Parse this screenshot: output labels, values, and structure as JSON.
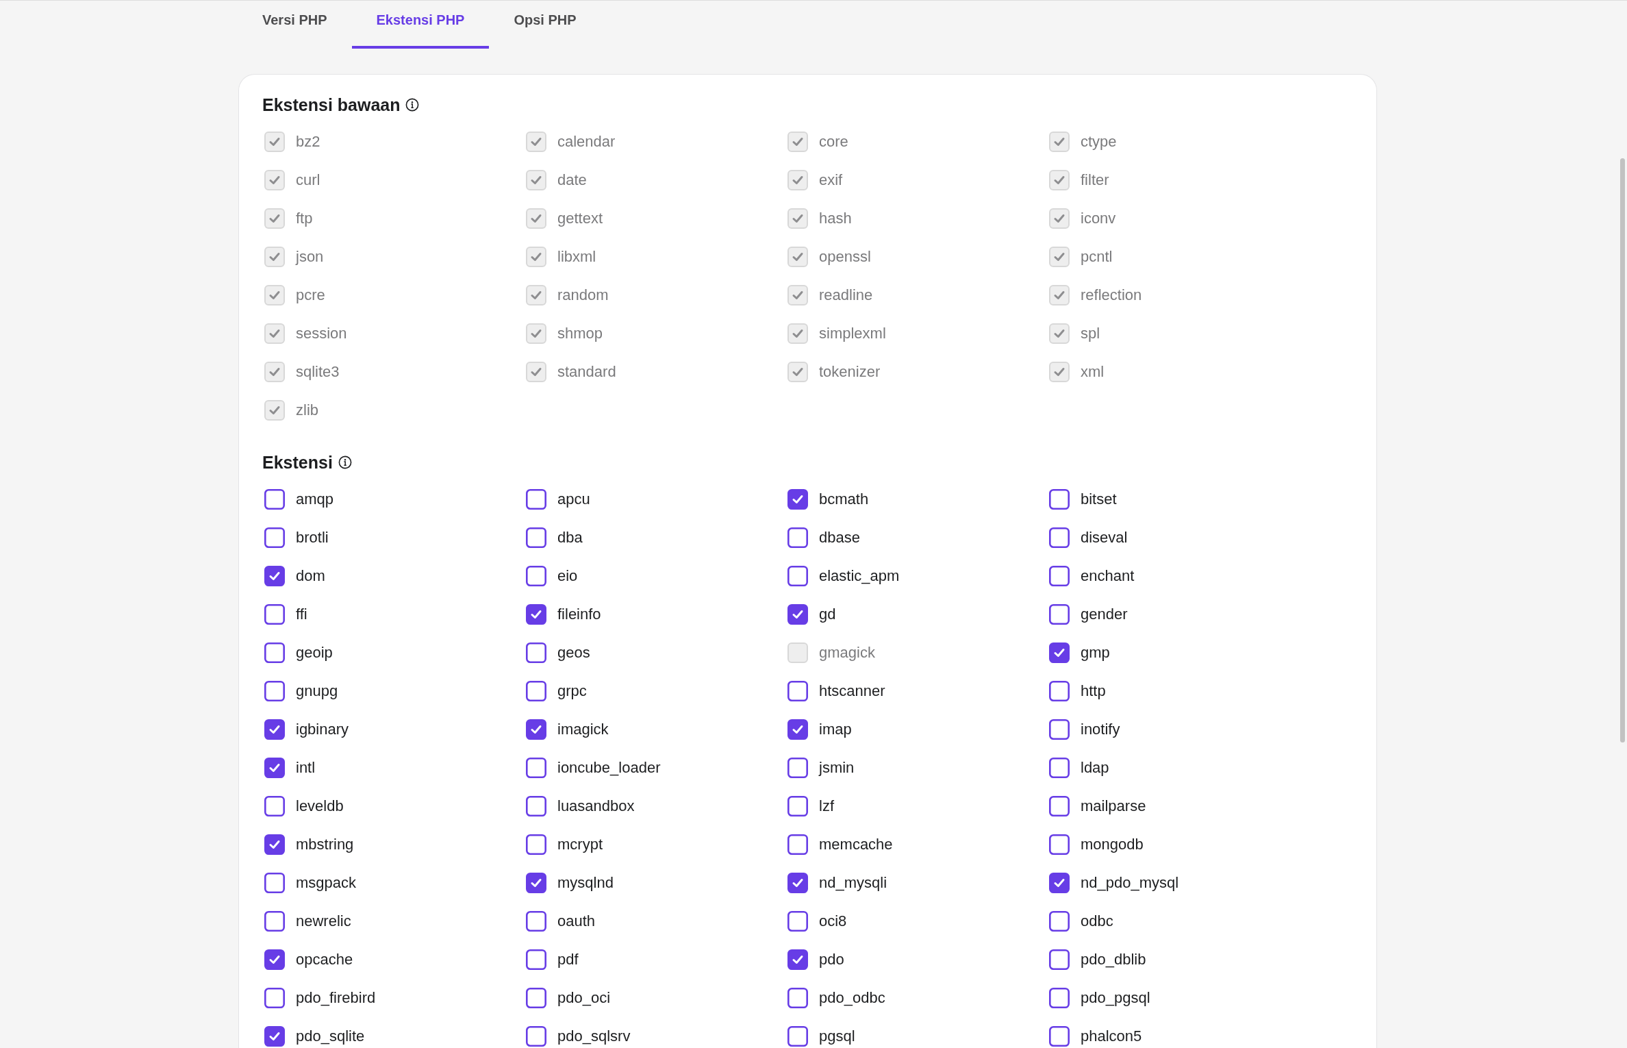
{
  "tabs": [
    {
      "label": "Versi PHP",
      "selected": false
    },
    {
      "label": "Ekstensi PHP",
      "selected": true
    },
    {
      "label": "Opsi PHP",
      "selected": false
    }
  ],
  "sections": [
    {
      "title": "Ekstensi bawaan",
      "items": [
        {
          "label": "bz2",
          "checked": true,
          "disabled": true
        },
        {
          "label": "calendar",
          "checked": true,
          "disabled": true
        },
        {
          "label": "core",
          "checked": true,
          "disabled": true
        },
        {
          "label": "ctype",
          "checked": true,
          "disabled": true
        },
        {
          "label": "curl",
          "checked": true,
          "disabled": true
        },
        {
          "label": "date",
          "checked": true,
          "disabled": true
        },
        {
          "label": "exif",
          "checked": true,
          "disabled": true
        },
        {
          "label": "filter",
          "checked": true,
          "disabled": true
        },
        {
          "label": "ftp",
          "checked": true,
          "disabled": true
        },
        {
          "label": "gettext",
          "checked": true,
          "disabled": true
        },
        {
          "label": "hash",
          "checked": true,
          "disabled": true
        },
        {
          "label": "iconv",
          "checked": true,
          "disabled": true
        },
        {
          "label": "json",
          "checked": true,
          "disabled": true
        },
        {
          "label": "libxml",
          "checked": true,
          "disabled": true
        },
        {
          "label": "openssl",
          "checked": true,
          "disabled": true
        },
        {
          "label": "pcntl",
          "checked": true,
          "disabled": true
        },
        {
          "label": "pcre",
          "checked": true,
          "disabled": true
        },
        {
          "label": "random",
          "checked": true,
          "disabled": true
        },
        {
          "label": "readline",
          "checked": true,
          "disabled": true
        },
        {
          "label": "reflection",
          "checked": true,
          "disabled": true
        },
        {
          "label": "session",
          "checked": true,
          "disabled": true
        },
        {
          "label": "shmop",
          "checked": true,
          "disabled": true
        },
        {
          "label": "simplexml",
          "checked": true,
          "disabled": true
        },
        {
          "label": "spl",
          "checked": true,
          "disabled": true
        },
        {
          "label": "sqlite3",
          "checked": true,
          "disabled": true
        },
        {
          "label": "standard",
          "checked": true,
          "disabled": true
        },
        {
          "label": "tokenizer",
          "checked": true,
          "disabled": true
        },
        {
          "label": "xml",
          "checked": true,
          "disabled": true
        },
        {
          "label": "zlib",
          "checked": true,
          "disabled": true
        }
      ]
    },
    {
      "title": "Ekstensi",
      "items": [
        {
          "label": "amqp",
          "checked": false,
          "disabled": false
        },
        {
          "label": "apcu",
          "checked": false,
          "disabled": false
        },
        {
          "label": "bcmath",
          "checked": true,
          "disabled": false
        },
        {
          "label": "bitset",
          "checked": false,
          "disabled": false
        },
        {
          "label": "brotli",
          "checked": false,
          "disabled": false
        },
        {
          "label": "dba",
          "checked": false,
          "disabled": false
        },
        {
          "label": "dbase",
          "checked": false,
          "disabled": false
        },
        {
          "label": "diseval",
          "checked": false,
          "disabled": false
        },
        {
          "label": "dom",
          "checked": true,
          "disabled": false
        },
        {
          "label": "eio",
          "checked": false,
          "disabled": false
        },
        {
          "label": "elastic_apm",
          "checked": false,
          "disabled": false
        },
        {
          "label": "enchant",
          "checked": false,
          "disabled": false
        },
        {
          "label": "ffi",
          "checked": false,
          "disabled": false
        },
        {
          "label": "fileinfo",
          "checked": true,
          "disabled": false
        },
        {
          "label": "gd",
          "checked": true,
          "disabled": false
        },
        {
          "label": "gender",
          "checked": false,
          "disabled": false
        },
        {
          "label": "geoip",
          "checked": false,
          "disabled": false
        },
        {
          "label": "geos",
          "checked": false,
          "disabled": false
        },
        {
          "label": "gmagick",
          "checked": false,
          "disabled": true
        },
        {
          "label": "gmp",
          "checked": true,
          "disabled": false
        },
        {
          "label": "gnupg",
          "checked": false,
          "disabled": false
        },
        {
          "label": "grpc",
          "checked": false,
          "disabled": false
        },
        {
          "label": "htscanner",
          "checked": false,
          "disabled": false
        },
        {
          "label": "http",
          "checked": false,
          "disabled": false
        },
        {
          "label": "igbinary",
          "checked": true,
          "disabled": false
        },
        {
          "label": "imagick",
          "checked": true,
          "disabled": false
        },
        {
          "label": "imap",
          "checked": true,
          "disabled": false
        },
        {
          "label": "inotify",
          "checked": false,
          "disabled": false
        },
        {
          "label": "intl",
          "checked": true,
          "disabled": false
        },
        {
          "label": "ioncube_loader",
          "checked": false,
          "disabled": false
        },
        {
          "label": "jsmin",
          "checked": false,
          "disabled": false
        },
        {
          "label": "ldap",
          "checked": false,
          "disabled": false
        },
        {
          "label": "leveldb",
          "checked": false,
          "disabled": false
        },
        {
          "label": "luasandbox",
          "checked": false,
          "disabled": false
        },
        {
          "label": "lzf",
          "checked": false,
          "disabled": false
        },
        {
          "label": "mailparse",
          "checked": false,
          "disabled": false
        },
        {
          "label": "mbstring",
          "checked": true,
          "disabled": false
        },
        {
          "label": "mcrypt",
          "checked": false,
          "disabled": false
        },
        {
          "label": "memcache",
          "checked": false,
          "disabled": false
        },
        {
          "label": "mongodb",
          "checked": false,
          "disabled": false
        },
        {
          "label": "msgpack",
          "checked": false,
          "disabled": false
        },
        {
          "label": "mysqlnd",
          "checked": true,
          "disabled": false
        },
        {
          "label": "nd_mysqli",
          "checked": true,
          "disabled": false
        },
        {
          "label": "nd_pdo_mysql",
          "checked": true,
          "disabled": false
        },
        {
          "label": "newrelic",
          "checked": false,
          "disabled": false
        },
        {
          "label": "oauth",
          "checked": false,
          "disabled": false
        },
        {
          "label": "oci8",
          "checked": false,
          "disabled": false
        },
        {
          "label": "odbc",
          "checked": false,
          "disabled": false
        },
        {
          "label": "opcache",
          "checked": true,
          "disabled": false
        },
        {
          "label": "pdf",
          "checked": false,
          "disabled": false
        },
        {
          "label": "pdo",
          "checked": true,
          "disabled": false
        },
        {
          "label": "pdo_dblib",
          "checked": false,
          "disabled": false
        },
        {
          "label": "pdo_firebird",
          "checked": false,
          "disabled": false
        },
        {
          "label": "pdo_oci",
          "checked": false,
          "disabled": false
        },
        {
          "label": "pdo_odbc",
          "checked": false,
          "disabled": false
        },
        {
          "label": "pdo_pgsql",
          "checked": false,
          "disabled": false
        },
        {
          "label": "pdo_sqlite",
          "checked": true,
          "disabled": false
        },
        {
          "label": "pdo_sqlsrv",
          "checked": false,
          "disabled": false
        },
        {
          "label": "pgsql",
          "checked": false,
          "disabled": false
        },
        {
          "label": "phalcon5",
          "checked": false,
          "disabled": false
        }
      ]
    }
  ]
}
